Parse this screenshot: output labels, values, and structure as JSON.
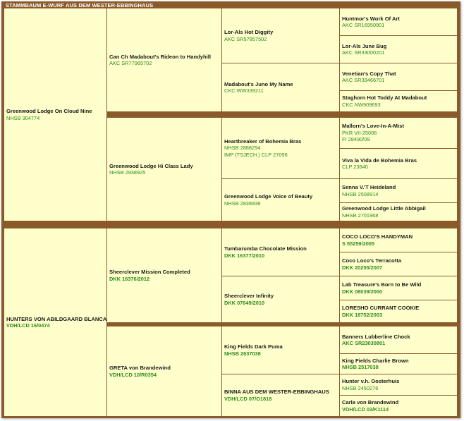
{
  "title": "STAMMBAUM E-WURF AUS DEM WESTER-EBBINGHAUS",
  "sire": {
    "name": "Greenwood Lodge On Cloud Nine",
    "reg": [
      "NHSB 304774"
    ],
    "sire": {
      "name": "Can Ch Madabout's Rideon to Handyhill",
      "reg": [
        "AKC SR77965702"
      ],
      "sire": {
        "name": "Lor-Als Hot Diggity",
        "reg": [
          "AKC SR57857502"
        ],
        "sire": {
          "name": "Huntmor's Work Of Art",
          "reg": [
            "AKC SR16950901"
          ]
        },
        "dam": {
          "name": "Lor-Als June Bug",
          "reg": [
            "AKC SR33000201"
          ]
        }
      },
      "dam": {
        "name": "Madabout's Juno My Name",
        "reg": [
          "CKC WW339211"
        ],
        "sire": {
          "name": "Venetian's Copy That",
          "reg": [
            "AKC SR39466701"
          ]
        },
        "dam": {
          "name": "Staghorn Hot Toddy At Madabout",
          "reg": [
            "CKC NW909693"
          ]
        }
      }
    },
    "dam": {
      "name": "Greenwood Lodge Hi Class Lady",
      "reg": [
        "NHSB 2938925"
      ],
      "sire": {
        "name": "Heartbreaker of Bohemia Bras",
        "reg": [
          "NHSB 2888294",
          "IMP (TSJECH.) CLP 27096"
        ],
        "sire": {
          "name": "Mallorn's Love-In-A-Mist",
          "reg": [
            "PKR VII-25006",
            "FI 28490/09"
          ]
        },
        "dam": {
          "name": "Viva la Vida de Bohemia Bras",
          "reg": [
            "CLP 23640"
          ]
        }
      },
      "dam": {
        "name": "Greenwood Lodge Voice of Beauty",
        "reg": [
          "NHSB 2838938"
        ],
        "sire": {
          "name": "Senna V.'T Heideland",
          "reg": [
            "NHSB 2508914"
          ]
        },
        "dam": {
          "name": "Greenwood Lodge Little Abbigail",
          "reg": [
            "NHSB 2701968"
          ]
        }
      }
    }
  },
  "dam": {
    "name": "HUNTERS VON ABILDGAARD BLANCA",
    "reg": [
      "VDH/LCD 16/0474"
    ],
    "sire": {
      "name": "Sheerclever Mission Completed",
      "reg": [
        "DKK 16376/2012"
      ],
      "sire": {
        "name": "Tumbarumba Chocolate Mission",
        "reg": [
          "DKK 16377/2010"
        ],
        "sire": {
          "name": "COCO LOCO'S HANDYMAN",
          "reg": [
            "S 55259/2005"
          ]
        },
        "dam": {
          "name": "Coco Loco's Terracotta",
          "reg": [
            "DKK 20255/2007"
          ]
        }
      },
      "dam": {
        "name": "Sheerclever Infinity",
        "reg": [
          "DKK 07649/2010"
        ],
        "sire": {
          "name": "Lab Treasure's Born to Be Wild",
          "reg": [
            "DKK 08039/2000"
          ]
        },
        "dam": {
          "name": "LORESHO CURRANT COOKIE",
          "reg": [
            "DKK 18752/2003"
          ]
        }
      }
    },
    "dam": {
      "name": "GRETA von Brandewind",
      "reg": [
        "VDH/LCD 10/R0354"
      ],
      "sire": {
        "name": "King Fields Dark Puma",
        "reg": [
          "NHSB 2637038"
        ],
        "sire": {
          "name": "Banners Lubberline Chock",
          "reg": [
            "AKC SR23030801"
          ]
        },
        "dam": {
          "name": "King Fields Charlie Brown",
          "reg": [
            "NHSB 2517038"
          ]
        }
      },
      "dam": {
        "name": "BINNA AUS DEM WESTER-EBBINGHAUS",
        "reg": [
          "VDH/LCD 07/O1818"
        ],
        "sire": {
          "name": "Hunter v.h. Oosterhuis",
          "reg": [
            "NHSB 2450276"
          ]
        },
        "dam": {
          "name": "Carla von Brandewind",
          "reg": [
            "VDH/LCD 03/K1114"
          ]
        }
      }
    }
  }
}
